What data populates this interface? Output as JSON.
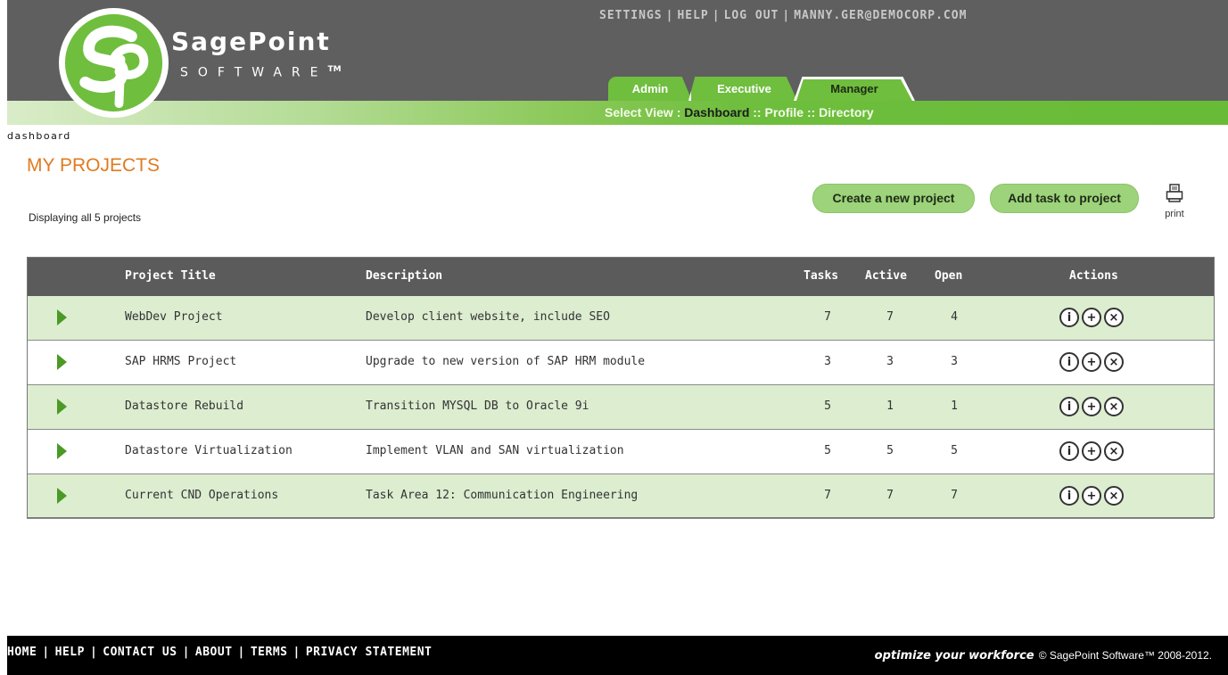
{
  "header": {
    "brand_name": "SagePoint",
    "brand_sub": "SOFTWARE",
    "brand_tm": "TM",
    "top_links": [
      "SETTINGS",
      "HELP",
      "LOG OUT",
      "MANNY.GER@DEMOCORP.COM"
    ],
    "tabs": [
      "Admin",
      "Executive",
      "Manager"
    ],
    "active_tab": "Manager",
    "subnav": {
      "label": "Select View",
      "items": [
        "Dashboard",
        "Profile",
        "Directory"
      ],
      "current": "Dashboard"
    },
    "colors": {
      "dark": "#5f5f5f",
      "green": "#6fbe3e",
      "title_orange": "#e07b1f"
    }
  },
  "main": {
    "breadcrumb": "dashboard",
    "title": "MY PROJECTS",
    "display_count": "Displaying all 5 projects",
    "buttons": {
      "create": "Create a new project",
      "add_task": "Add task to project"
    },
    "print_label": "print",
    "print_icon": "printer-icon"
  },
  "table": {
    "columns": [
      "Project Title",
      "Description",
      "Tasks",
      "Active",
      "Open",
      "Actions"
    ],
    "action_icons": [
      "info-icon",
      "add-icon",
      "remove-icon"
    ],
    "action_glyphs": [
      "i",
      "+",
      "×"
    ],
    "rows": [
      {
        "title": "WebDev Project",
        "description": "Develop client website, include SEO",
        "tasks": "7",
        "active": "7",
        "open": "4"
      },
      {
        "title": "SAP HRMS Project",
        "description": "Upgrade to new version of SAP HRM module",
        "tasks": "3",
        "active": "3",
        "open": "3"
      },
      {
        "title": "Datastore Rebuild",
        "description": "Transition MYSQL DB to Oracle 9i",
        "tasks": "5",
        "active": "1",
        "open": "1"
      },
      {
        "title": "Datastore Virtualization",
        "description": "Implement VLAN and SAN virtualization",
        "tasks": "5",
        "active": "5",
        "open": "5"
      },
      {
        "title": "Current CND Operations",
        "description": "Task Area 12: Communication Engineering",
        "tasks": "7",
        "active": "7",
        "open": "7"
      }
    ]
  },
  "footer": {
    "links": [
      "HOME",
      "HELP",
      "CONTACT US",
      "ABOUT",
      "TERMS",
      "PRIVACY STATEMENT"
    ],
    "tagline": "optimize your workforce",
    "copyright": "© SagePoint Software™ 2008-2012."
  }
}
